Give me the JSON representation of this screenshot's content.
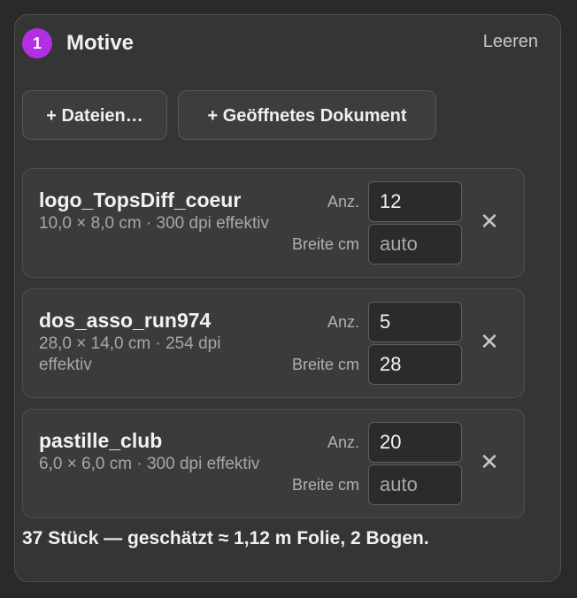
{
  "header": {
    "step_number": "1",
    "title": "Motive",
    "clear_label": "Leeren"
  },
  "actions": {
    "add_files_label": "+ Dateien…",
    "add_open_document_label": "+ Geöffnetes Dokument"
  },
  "field_labels": {
    "quantity": "Anz.",
    "width": "Breite cm"
  },
  "motifs": [
    {
      "name": "logo_TopsDiff_coeur",
      "meta": "10,0 × 8,0 cm · 300 dpi effektiv",
      "quantity": "12",
      "width_value": "",
      "width_placeholder": "auto"
    },
    {
      "name": "dos_asso_run974",
      "meta": "28,0 × 14,0 cm · 254 dpi effektiv",
      "quantity": "5",
      "width_value": "28",
      "width_placeholder": "auto"
    },
    {
      "name": "pastille_club",
      "meta": "6,0 × 6,0 cm · 300 dpi effektiv",
      "quantity": "20",
      "width_value": "",
      "width_placeholder": "auto"
    }
  ],
  "remove_glyph": "✕",
  "summary": "37 Stück — geschätzt ≈ 1,12 m Folie, 2 Bogen.",
  "colors": {
    "accent": "#b22fe4",
    "panel_bg": "#353535",
    "card_bg": "#3b3b3b",
    "input_bg": "#2b2b2b"
  }
}
